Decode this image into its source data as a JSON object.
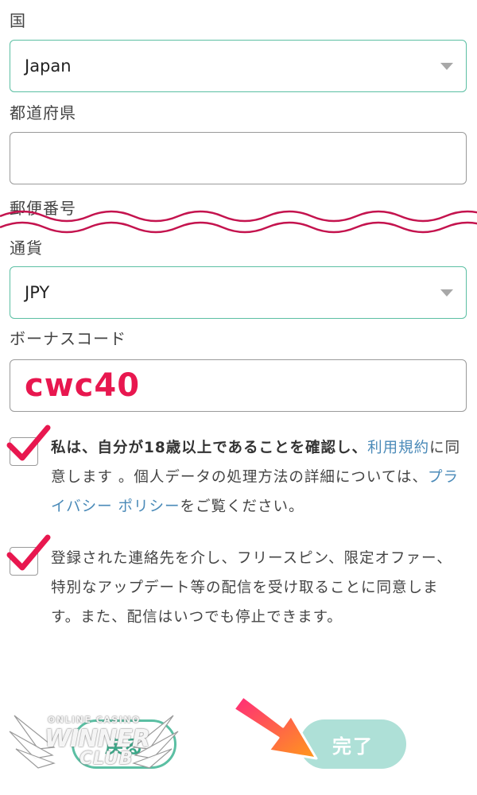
{
  "form": {
    "country": {
      "label": "国",
      "value": "Japan"
    },
    "prefecture": {
      "label": "都道府県",
      "value": ""
    },
    "postal_code": {
      "label": "郵便番号"
    },
    "currency": {
      "label": "通貨",
      "value": "JPY"
    },
    "bonus_code": {
      "label": "ボーナスコード",
      "value": "cwc40"
    }
  },
  "consents": {
    "age": {
      "bold": "私は、自分が18歳以上であることを確認し、",
      "terms_link": "利用規約",
      "text1": "に同意します 。個人データの処理方法の詳細については、",
      "privacy_link": "プライバシー ポリシー",
      "text2": "をご覧ください。"
    },
    "marketing": {
      "text": "登録された連絡先を介し、フリースピン、限定オファー、特別なアップデート等の配信を受け取ることに同意します。また、配信はいつでも停止できます。"
    }
  },
  "buttons": {
    "back": "戻る",
    "done": "完了"
  },
  "watermark": {
    "top": "ONLINE CASINO",
    "main": "WINNER",
    "sub": "CLUB"
  },
  "icons": {
    "caret": "triangle-down-icon",
    "check": "checkmark-icon",
    "arrow": "pointer-arrow-icon"
  },
  "colors": {
    "accent": "#5bbfa3",
    "highlight": "#e8174f",
    "link": "#4a8ab8",
    "done_button": "#aee0d7"
  }
}
